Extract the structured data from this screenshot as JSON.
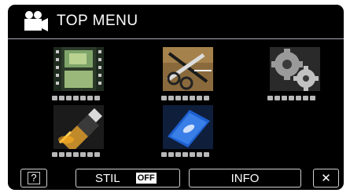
{
  "title": {
    "text": "TOP MENU",
    "icon": "movie-camera-icon"
  },
  "menu_items": [
    {
      "icon": "film-strip-icon"
    },
    {
      "icon": "scissors-editing-icon"
    },
    {
      "icon": "gear-settings-icon"
    },
    {
      "icon": "usb-connector-icon"
    },
    {
      "icon": "blue-disc-icon"
    }
  ],
  "bottom_bar": {
    "help_label": "?",
    "stil_label": "STIL",
    "stil_state": "OFF",
    "info_label": "INFO",
    "close_label": "✕"
  }
}
